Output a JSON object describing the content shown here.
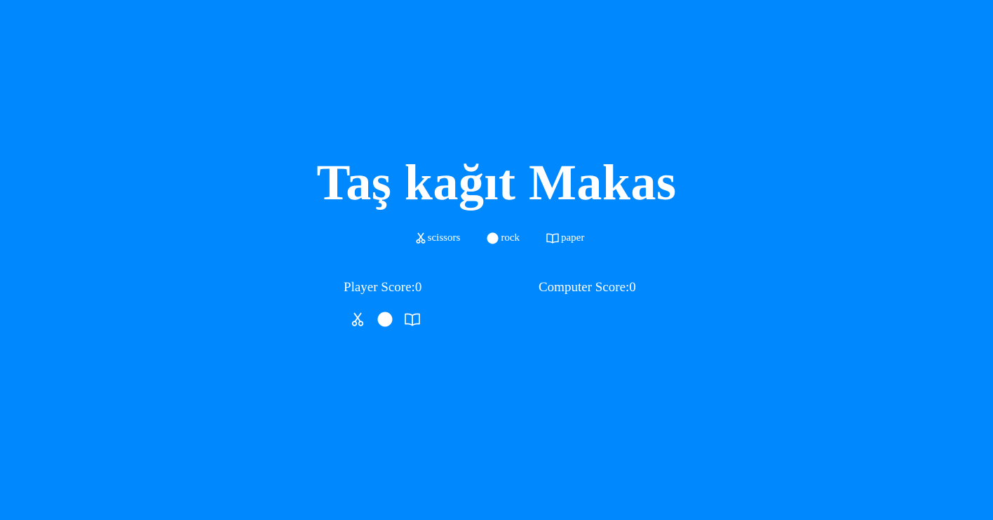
{
  "title": "Taş kağıt Makas",
  "legend": {
    "scissors": {
      "icon": "scissors-icon",
      "label": "scissors"
    },
    "rock": {
      "icon": "circle-icon",
      "label": "rock"
    },
    "paper": {
      "icon": "book-icon",
      "label": "paper"
    }
  },
  "scores": {
    "player": "Player Score:0",
    "computer": "Computer Score:0"
  },
  "choices": [
    "scissors-icon",
    "circle-icon",
    "book-icon"
  ],
  "colors": {
    "background": "#0088ff",
    "foreground": "#ffffff"
  }
}
